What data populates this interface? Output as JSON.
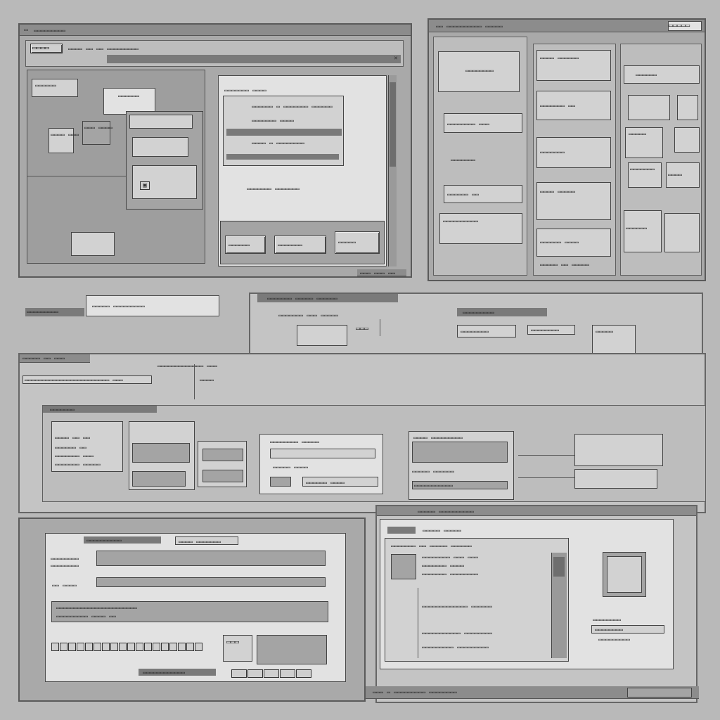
{
  "win_tl": {
    "title": "▭▭▭▭▭▭▭▭▭",
    "toolbar": "▭▭▭▭  ▭▭ ▭▭  ▭▭▭▭▭▭▭▭▭",
    "logo": "▭▭▭▭",
    "side_items": [
      "▭▭▭▭▭▭",
      "▭▭▭▭ ▭▭▭",
      "▭▭▭ ▭▭▭▭",
      "▭▭▭▭▭▭"
    ],
    "dialog_title": "▭▭▭▭▭▭▭ ▭▭▭▭",
    "dialog_rows": [
      "▭▭▭▭▭▭ ▭ ▭▭▭▭▭▭▭ ▭▭▭▭▭▭",
      "▭▭▭▭▭▭▭ ▭▭▭▭",
      "▭▭▭▭ ▭ ▭▭▭▭▭▭▭▭",
      "▭▭▭▭▭▭▭ ▭▭▭▭▭▭▭"
    ],
    "footer_btns": [
      "▭▭▭▭▭▭",
      "▭▭▭▭▭▭▭",
      "▭▭▭▭▭"
    ],
    "status": "▭▭▭ ▭▭▭ ▭▭"
  },
  "win_tr": {
    "title": "▭▭ ▭▭▭▭▭▭▭▭▭▭ ▭▭▭▭▭",
    "right_title": "▭▭▭▭▭",
    "col1": [
      "▭▭▭▭▭▭▭▭",
      "▭▭▭▭▭▭▭▭ ▭▭▭",
      "▭▭▭▭▭▭▭",
      "▭▭▭▭▭▭ ▭▭",
      "▭▭▭▭▭▭▭▭▭▭"
    ],
    "col2": [
      "▭▭▭▭ ▭▭▭▭▭▭",
      "▭▭▭▭▭▭▭ ▭▭",
      "▭▭▭▭▭▭▭",
      "▭▭▭▭ ▭▭▭▭▭",
      "▭▭▭▭▭▭ ▭▭▭▭"
    ],
    "col3": [
      "▭▭▭▭▭▭",
      "▭▭▭▭▭",
      "▭▭▭▭▭▭▭",
      "▭▭▭▭",
      "▭▭▭▭▭▭"
    ],
    "footer": "▭▭▭▭▭ ▭▭ ▭▭▭▭▭"
  },
  "mid_strip": {
    "left_label": "▭▭▭▭▭▭▭▭▭",
    "left_box": "▭▭▭▭▭ ▭▭▭▭▭▭▭▭▭",
    "tab_label": "▭▭▭▭▭▭▭ ▭▭▭▭▭ ▭▭▭▭▭▭",
    "sub_label": "▭▭▭▭▭▭▭ ▭▭▭ ▭▭▭▭▭",
    "value": "▭▭▭",
    "right_btns": [
      "▭▭▭▭▭▭▭▭",
      "▭▭▭▭▭▭▭▭",
      "▭▭▭▭▭"
    ],
    "right_tag": "▭▭▭▭▭▭▭▭▭"
  },
  "win_mid": {
    "title": "▭▭▭▭▭ ▭▭ ▭▭▭",
    "path": "▭▭▭▭▭▭▭▭▭▭▭▭▭ ▭▭▭",
    "crumbs": "▭▭▭▭▭▭▭▭▭▭▭▭▭▭▭▭▭▭▭▭▭▭▭▭ ▭▭▭",
    "field": "▭▭▭▭",
    "inner_title": "▭▭▭▭▭▭▭",
    "rows": [
      "▭▭▭▭ ▭▭ ▭▭",
      "▭▭▭▭▭▭ ▭▭",
      "▭▭▭▭▭▭▭ ▭▭▭",
      "▭▭▭▭▭▭▭ ▭▭▭▭▭"
    ],
    "center_rows": [
      "▭▭▭▭▭▭▭▭ ▭▭▭▭▭",
      "▭▭▭▭▭ ▭▭▭▭",
      "▭▭▭▭▭▭ ▭▭▭▭"
    ],
    "right_rows": [
      "▭▭▭▭ ▭▭▭▭▭▭▭▭▭",
      "▭▭▭▭▭ ▭▭▭▭▭▭",
      "▭▭▭▭▭▭▭▭▭▭▭"
    ]
  },
  "win_bl": {
    "header": "▭▭▭▭▭▭▭▭▭▭",
    "tab": "▭▭▭▭ ▭▭▭▭▭▭▭",
    "labels": [
      "▭▭▭▭▭▭▭▭",
      "▭▭▭▭▭▭▭▭",
      "▭▭ ▭▭▭▭"
    ],
    "panel_rows": [
      "▭▭▭▭▭▭▭▭▭▭▭▭▭▭▭▭▭▭▭▭▭▭▭",
      "▭▭▭▭▭▭▭▭▭ ▭▭▭▭ ▭▭"
    ],
    "code": "▭▭▭",
    "status": "▭▭▭▭▭▭▭▭▭▭▭▭",
    "side_text": [
      "▭▭▭▭▭ ▭▭▭▭▭",
      "▭▭▭▭▭▭▭▭",
      "▭▭▭▭▭▭ ▭▭"
    ]
  },
  "win_br": {
    "title": "▭▭▭▭▭ ▭▭▭▭▭▭▭▭▭▭",
    "tab": "▭▭▭▭▭ ▭▭▭▭▭",
    "heading": "▭▭▭▭▭▭▭ ▭▭ ▭▭▭▭▭ ▭▭▭▭▭▭",
    "list": [
      "▭▭▭▭▭▭▭▭ ▭▭▭ ▭▭▭",
      "▭▭▭▭▭▭▭ ▭▭▭▭",
      "▭▭▭▭▭▭▭ ▭▭▭▭▭▭▭▭",
      "▭▭▭▭▭▭▭▭▭▭▭▭▭ ▭▭▭▭▭▭",
      "▭▭▭▭▭▭▭▭▭▭▭ ▭▭▭▭▭▭▭▭",
      "▭▭▭▭▭▭▭▭▭ ▭▭▭▭▭▭▭▭▭"
    ],
    "right_label": "▭▭▭▭▭▭▭▭",
    "right_rows": [
      "▭▭▭▭▭▭▭▭",
      "▭▭▭▭▭▭▭▭▭"
    ],
    "taskbar": "▭▭▭ ▭ ▭▭▭▭▭▭▭▭▭ ▭▭▭▭▭▭▭▭"
  }
}
